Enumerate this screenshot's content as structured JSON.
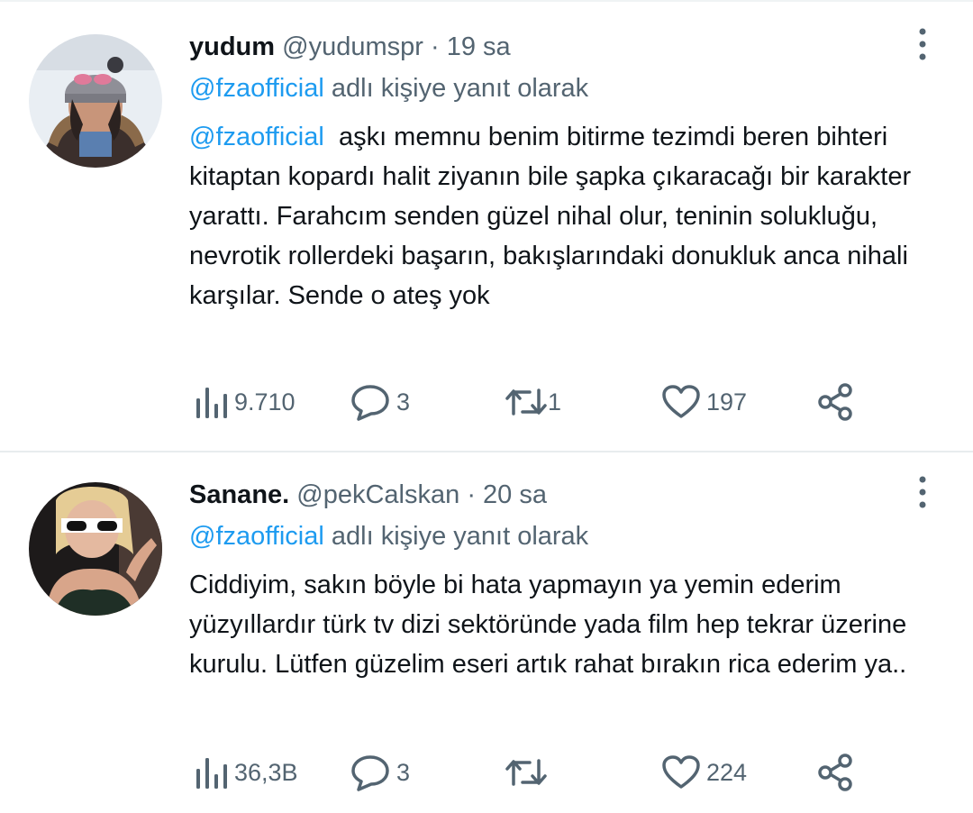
{
  "tweets": [
    {
      "name": "yudum",
      "handle": "@yudumspr",
      "separator": "·",
      "time": "19 sa",
      "reply_mention": "@fzaofficial",
      "reply_suffix": "adlı kişiye yanıt olarak",
      "text_mention": "@fzaofficial",
      "text": "aşkı memnu benim bitirme tezimdi beren bihteri kitaptan kopardı halit ziyanın bile şapka çıkaracağı bir karakter yarattı. Farahcım senden güzel nihal olur, teninin solukluğu, nevrotik rollerdeki başarın, bakışlarındaki donukluk anca nihali karşılar. Sende o ateş yok",
      "views": "9.710",
      "replies": "3",
      "retweets": "1",
      "likes": "197"
    },
    {
      "name": "Sanane.",
      "handle": "@pekCalskan",
      "separator": "·",
      "time": "20 sa",
      "reply_mention": "@fzaofficial",
      "reply_suffix": "adlı kişiye yanıt olarak",
      "text": "Ciddiyim, sakın böyle bi hata yapmayın ya yemin ederim yüzyıllardır türk tv dizi sektöründe yada film hep tekrar üzerine kurulu. Lütfen güzelim eseri artık rahat bırakın rica ederim ya..",
      "views": "36,3B",
      "replies": "3",
      "likes": "224"
    }
  ],
  "icons": {
    "views": "bar-chart-icon",
    "reply": "speech-bubble-icon",
    "retweet": "retweet-arrows-icon",
    "like": "heart-icon",
    "share": "share-nodes-icon",
    "more": "vertical-dots-icon"
  },
  "colors": {
    "mention": "#1d9bf0",
    "secondary_text": "#536471",
    "primary_text": "#0f1419"
  }
}
